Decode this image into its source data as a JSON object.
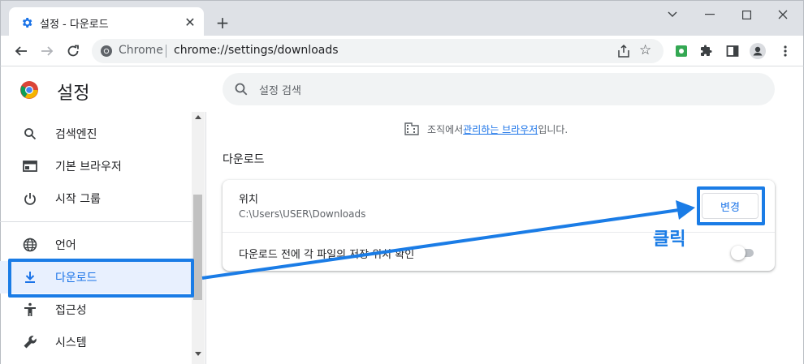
{
  "tab": {
    "title": "설정 - 다운로드",
    "close_icon": "close-icon",
    "favicon": "gear-icon"
  },
  "window": {
    "new_tab_label": "+",
    "controls": [
      "chevron-down-icon",
      "minimize-icon",
      "maximize-icon",
      "close-icon"
    ]
  },
  "omnibox": {
    "site_label": "Chrome",
    "url": "chrome://settings/downloads"
  },
  "settings": {
    "title": "설정",
    "search_placeholder": "설정 검색"
  },
  "sidebar": {
    "items": [
      {
        "label": "검색엔진",
        "icon": "search-icon",
        "active": false
      },
      {
        "label": "기본 브라우저",
        "icon": "browser-icon",
        "active": false
      },
      {
        "label": "시작 그룹",
        "icon": "power-icon",
        "active": false
      },
      {
        "label": "언어",
        "icon": "globe-icon",
        "active": false
      },
      {
        "label": "다운로드",
        "icon": "download-icon",
        "active": true
      },
      {
        "label": "접근성",
        "icon": "accessibility-icon",
        "active": false
      },
      {
        "label": "시스템",
        "icon": "wrench-icon",
        "active": false
      }
    ]
  },
  "managed": {
    "prefix": "조직에서 ",
    "link": "관리하는 브라우저",
    "suffix": "입니다."
  },
  "downloads": {
    "section_title": "다운로드",
    "location_label": "위치",
    "location_value": "C:\\Users\\USER\\Downloads",
    "change_button": "변경",
    "ask_label": "다운로드 전에 각 파일의 저장 위치 확인",
    "ask_enabled": false
  },
  "annotation": {
    "click_label": "클릭"
  },
  "colors": {
    "accent": "#1a73e8",
    "annotation": "#1a7ce6",
    "active_bg": "#e8f0fe"
  }
}
